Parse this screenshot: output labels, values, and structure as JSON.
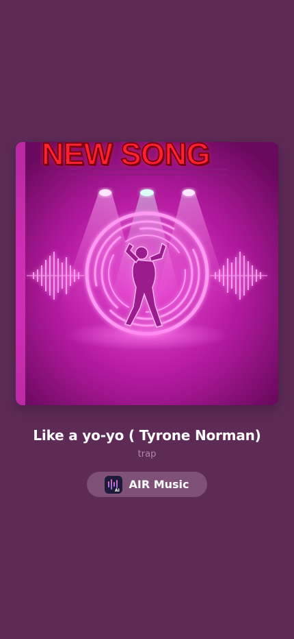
{
  "artwork": {
    "label": "NEW SONG",
    "icon": "dancer-neon-ring-artwork"
  },
  "song": {
    "title": "Like a yo-yo ( Tyrone Norman)",
    "genre": "trap"
  },
  "app_chip": {
    "name": "AIR Music",
    "icon": "air-music-logo-icon",
    "icon_badge": "AI"
  },
  "colors": {
    "background": "#5e2b57",
    "chip": "#7f5178",
    "neon": "#ff3fd8",
    "label_red": "#ff2030"
  }
}
